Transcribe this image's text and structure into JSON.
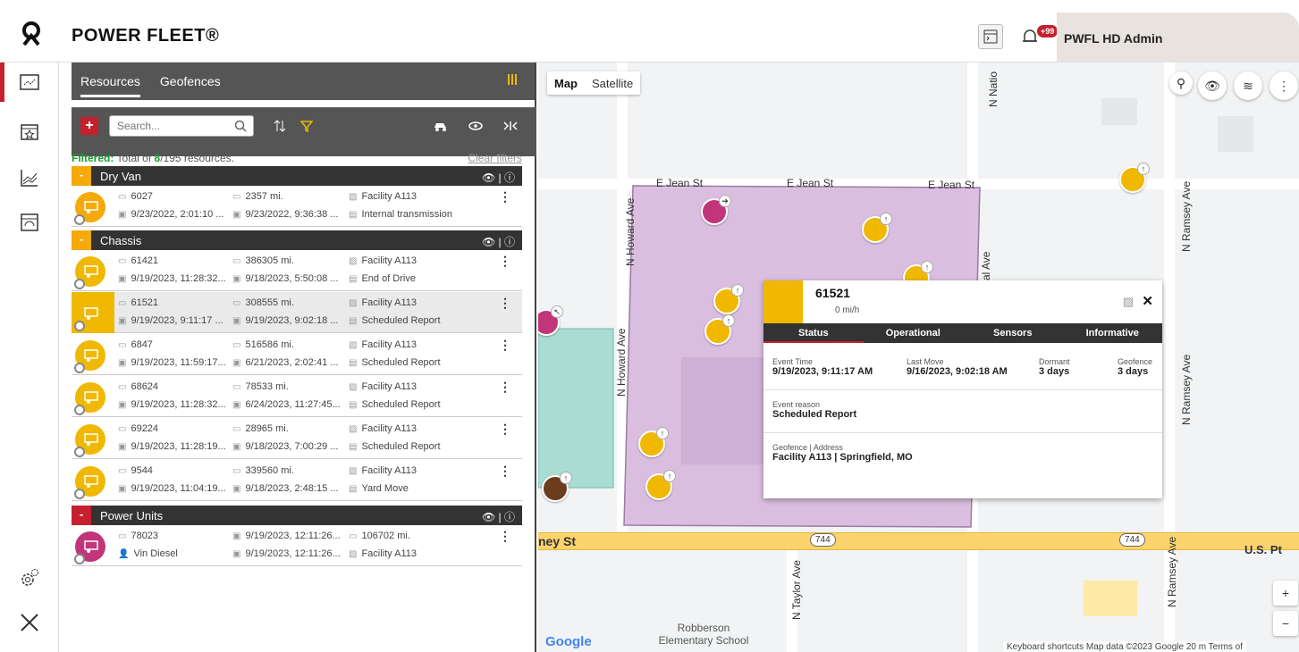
{
  "header": {
    "brand": "POWER FLEET®",
    "notification_count": "+99",
    "user_name": "PWFL HD Admin"
  },
  "rail": {
    "items": [
      "map-icon",
      "calendar-icon",
      "chart-icon",
      "dashboard-icon"
    ],
    "bottom": [
      "settings-icon",
      "tools-icon"
    ]
  },
  "panel": {
    "tabs": [
      "Resources",
      "Geofences"
    ],
    "search_placeholder": "Search...",
    "filter_label": "Filtered:",
    "filter_text_pre": "Total of ",
    "filter_count": "8",
    "filter_text_post": "/195 resources.",
    "clear_filters": "Clear filters",
    "groups": [
      {
        "name": "Dry Van"
      },
      {
        "name": "Chassis"
      },
      {
        "name": "Power Units"
      }
    ],
    "rows": [
      {
        "id": "6027",
        "mileage": "2357 mi.",
        "location": "Facility A113",
        "event_time": "9/23/2022, 2:01:10 ...",
        "last_move": "9/23/2022, 9:36:38 ...",
        "reason": "Internal transmission"
      },
      {
        "id": "61421",
        "mileage": "386305 mi.",
        "location": "Facility A113",
        "event_time": "9/19/2023, 11:28:32...",
        "last_move": "9/18/2023, 5:50:08 ...",
        "reason": "End of Drive"
      },
      {
        "id": "61521",
        "mileage": "308555 mi.",
        "location": "Facility A113",
        "event_time": "9/19/2023, 9:11:17 ...",
        "last_move": "9/19/2023, 9:02:18 ...",
        "reason": "Scheduled Report"
      },
      {
        "id": "6847",
        "mileage": "516586 mi.",
        "location": "Facility A113",
        "event_time": "9/19/2023, 11:59:17...",
        "last_move": "6/21/2023, 2:02:41 ...",
        "reason": "Scheduled Report"
      },
      {
        "id": "68624",
        "mileage": "78533 mi.",
        "location": "Facility A113",
        "event_time": "9/19/2023, 11:28:32...",
        "last_move": "6/24/2023, 11:27:45...",
        "reason": "Scheduled Report"
      },
      {
        "id": "69224",
        "mileage": "28965 mi.",
        "location": "Facility A113",
        "event_time": "9/19/2023, 11:28:19...",
        "last_move": "9/18/2023, 7:00:29 ...",
        "reason": "Scheduled Report"
      },
      {
        "id": "9544",
        "mileage": "339560 mi.",
        "location": "Facility A113",
        "event_time": "9/19/2023, 11:04:19...",
        "last_move": "9/18/2023, 2:48:15 ...",
        "reason": "Yard Move"
      },
      {
        "id": "78023",
        "driver": "Vin Diesel",
        "event_time": "9/19/2023, 12:11:26...",
        "last_move": "9/19/2023, 12:11:26...",
        "mileage": "106702 mi.",
        "location": "Facility A113"
      }
    ]
  },
  "map": {
    "toggle": [
      "Map",
      "Satellite"
    ],
    "streets": [
      "E Jean St",
      "E Jean St",
      "E Jean St",
      "N Howard Ave",
      "N Howard Ave",
      "N Ramsey Ave",
      "N Ramsey Ave",
      "N Ramsey Ave",
      "N Taylor Ave",
      "N Natio",
      "al Ave",
      "ney St",
      "U.S. Pt"
    ],
    "route_shields": [
      "744",
      "744"
    ],
    "poi": "Robberson Elementary School",
    "google": "Google",
    "attribution": "Keyboard shortcuts  Map data ©2023 Google  20 m  Terms of"
  },
  "popup": {
    "id": "61521",
    "speed": "0 mi/h",
    "tabs": [
      "Status",
      "Operational",
      "Sensors",
      "Informative"
    ],
    "event_time_label": "Event Time",
    "event_time": "9/19/2023, 9:11:17 AM",
    "last_move_label": "Last Move",
    "last_move": "9/16/2023, 9:02:18 AM",
    "dormant_label": "Dormant",
    "dormant": "3 days",
    "geofence_label": "Geofence",
    "geofence": "3 days",
    "event_reason_label": "Event reason",
    "event_reason": "Scheduled Report",
    "geo_addr_label": "Geofence | Address",
    "geo_addr": "Facility A113 | Springfield, MO"
  },
  "colors": {
    "accent": "#c6202e",
    "yellow": "#f0b800",
    "orange": "#f5a90a",
    "magenta": "#c2357a",
    "geofence": "#d6b4dc",
    "teal": "#a9dcd2"
  }
}
